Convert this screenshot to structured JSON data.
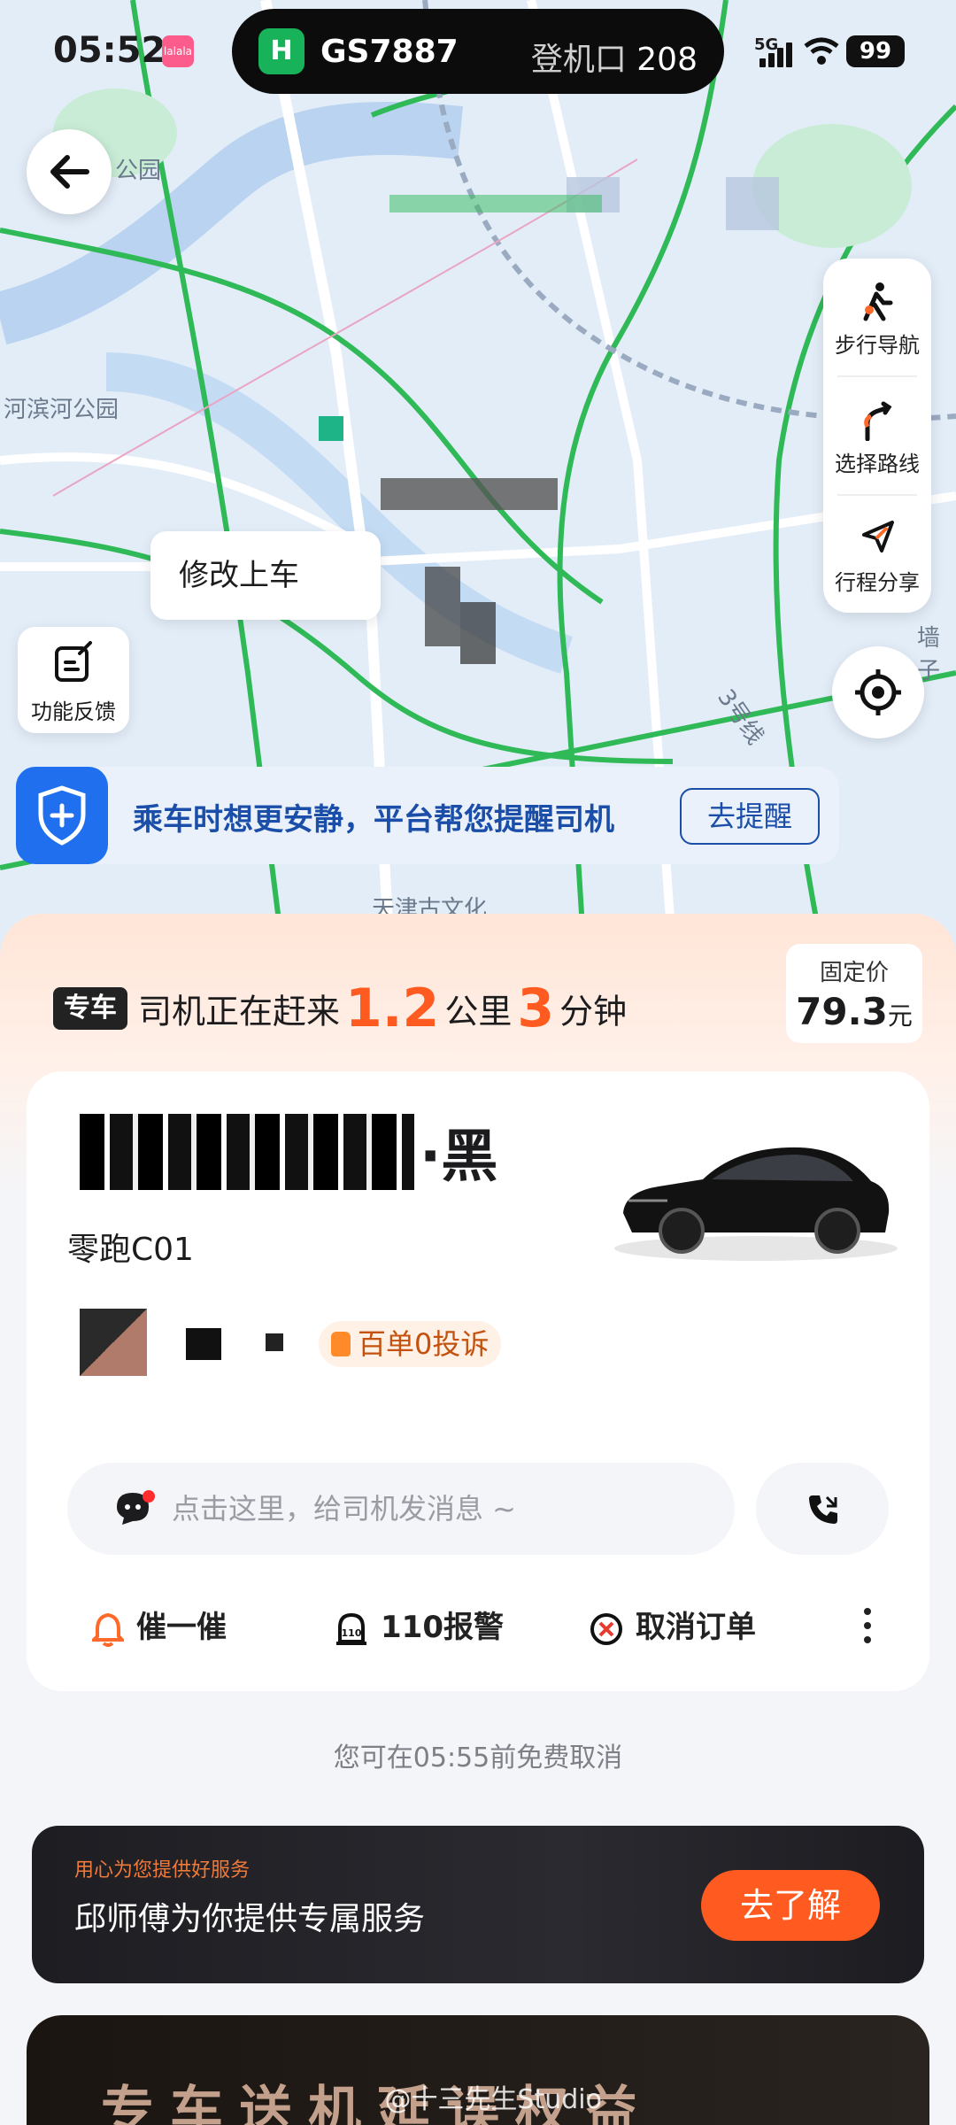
{
  "status_bar": {
    "time": "05:52",
    "time_badge": "lalala",
    "flight_number": "GS7887",
    "gate_label": "登机口",
    "gate_number": "208",
    "network": "5G",
    "battery": "99"
  },
  "map": {
    "labels": [
      "公园",
      "河滨河公园",
      "3号线",
      "天津古文化",
      "墙子"
    ],
    "pickup_bubble": "修改上车",
    "feedback_label": "功能反馈",
    "side_tools": [
      {
        "label": "步行导航",
        "icon": "walk-icon"
      },
      {
        "label": "选择路线",
        "icon": "route-icon"
      },
      {
        "label": "行程分享",
        "icon": "share-icon"
      }
    ]
  },
  "notice": {
    "text": "乘车时想更安静，平台帮您提醒司机",
    "button": "去提醒"
  },
  "trip": {
    "tag": "专车",
    "prefix": "司机正在赶来",
    "distance": "1.2",
    "distance_unit": "公里",
    "minutes": "3",
    "minutes_unit": "分钟",
    "price_label": "固定价",
    "price": "79.3",
    "price_unit": "元"
  },
  "driver_card": {
    "plate_suffix": "·黑",
    "car_model": "零跑C01",
    "badge": "百单0投诉",
    "message_placeholder": "点击这里，给司机发消息 ~",
    "actions": [
      {
        "label": "催一催",
        "icon": "bell-icon"
      },
      {
        "label": "110报警",
        "icon": "alarm-icon"
      },
      {
        "label": "取消订单",
        "icon": "cancel-icon"
      }
    ]
  },
  "free_cancel": "您可在05:55前免费取消",
  "promo": {
    "subtitle": "用心为您提供好服务",
    "title": "邱师傅为你提供专属服务",
    "button": "去了解"
  },
  "bottom_banner": {
    "title": "专车送机延误权益"
  },
  "watermark": "@十三先生Studio",
  "colors": {
    "accent": "#ff5a1f",
    "notice_blue": "#1f6fef",
    "road_green": "#2fb957",
    "flight_logo": "#17b25a"
  }
}
